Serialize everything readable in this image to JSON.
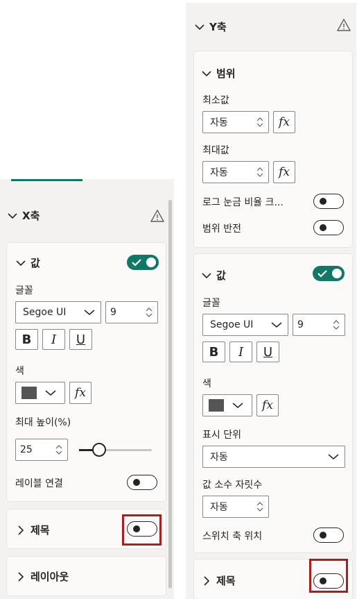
{
  "left_pane": {
    "section_title": "X축",
    "value_card": {
      "title": "값",
      "toggle_on": true,
      "font_label": "글꼴",
      "font_family": "Segoe UI",
      "font_size": "9",
      "bold": "B",
      "italic": "I",
      "underline": "U",
      "color_label": "색",
      "fx": "fx",
      "max_height_label": "최대 높이(%)",
      "max_height_value": "25",
      "max_height_level": 0.28,
      "label_concat_label": "레이블 연결",
      "label_concat_on": false
    },
    "title_card": {
      "label": "제목",
      "toggle_on": false
    },
    "layout_card": {
      "label": "레이아웃"
    }
  },
  "right_pane": {
    "section_title": "Y축",
    "range_card": {
      "title": "범위",
      "min_label": "최소값",
      "min_value": "자동",
      "max_label": "최대값",
      "max_value": "자동",
      "fx": "fx",
      "log_scale_label": "로그 눈금 비율 크...",
      "log_scale_on": false,
      "invert_range_label": "범위 반전",
      "invert_range_on": false
    },
    "value_card": {
      "title": "값",
      "toggle_on": true,
      "font_label": "글꼴",
      "font_family": "Segoe UI",
      "font_size": "9",
      "bold": "B",
      "italic": "I",
      "underline": "U",
      "color_label": "색",
      "fx": "fx",
      "display_units_label": "표시 단위",
      "display_units_value": "자동",
      "decimal_places_label": "값 소수 자릿수",
      "decimal_places_value": "자동",
      "switch_axis_label": "스위치 축 위치",
      "switch_axis_on": false
    },
    "title_card": {
      "label": "제목",
      "toggle_on": false
    }
  },
  "colors": {
    "accent_green": "#117865",
    "highlight_red": "#b01c1c",
    "font_color_swatch": "#555555",
    "pane_bg": "#f3f2f1"
  },
  "icons": [
    "chevron-down-icon",
    "chevron-right-icon",
    "warning-icon",
    "checkmark-icon",
    "spinner-arrows-icon"
  ]
}
